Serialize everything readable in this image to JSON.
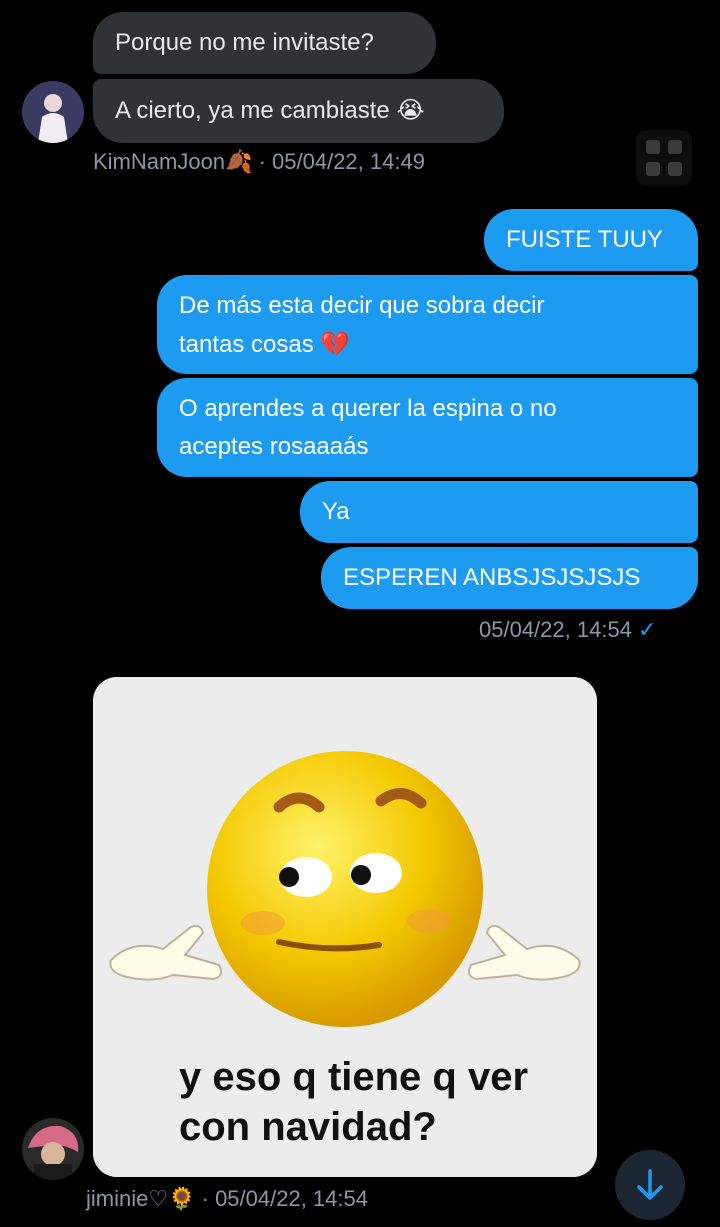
{
  "incoming_top": {
    "messages": [
      {
        "text": "Porque no me invitaste?"
      },
      {
        "text": "A cierto, ya me cambiaste",
        "emoji": "😭"
      }
    ],
    "sender": "KimNamJoon",
    "sender_emoji": "🍂",
    "timestamp": "05/04/22, 14:49"
  },
  "outgoing": {
    "messages": [
      {
        "line1": "FUISTE TUUY"
      },
      {
        "line1": "De más esta decir que sobra decir",
        "line2": "tantas cosas",
        "emoji": "💔"
      },
      {
        "line1": "O aprendes a querer la espina o no",
        "line2": "aceptes rosaaaás"
      },
      {
        "line1": "Ya"
      },
      {
        "line1": "ESPEREN ANBSJSJSJSJS"
      }
    ],
    "timestamp": "05/04/22, 14:54",
    "status_icon": "✓"
  },
  "incoming_bottom": {
    "meme_caption_line1": "y eso q tiene q ver",
    "meme_caption_line2": "con navidad?",
    "sender": "jiminie♡",
    "sender_emoji": "🌻",
    "timestamp": "05/04/22, 14:54"
  },
  "icons": {
    "scroll_down": "arrow-down-icon",
    "grid": "grid-icon"
  }
}
